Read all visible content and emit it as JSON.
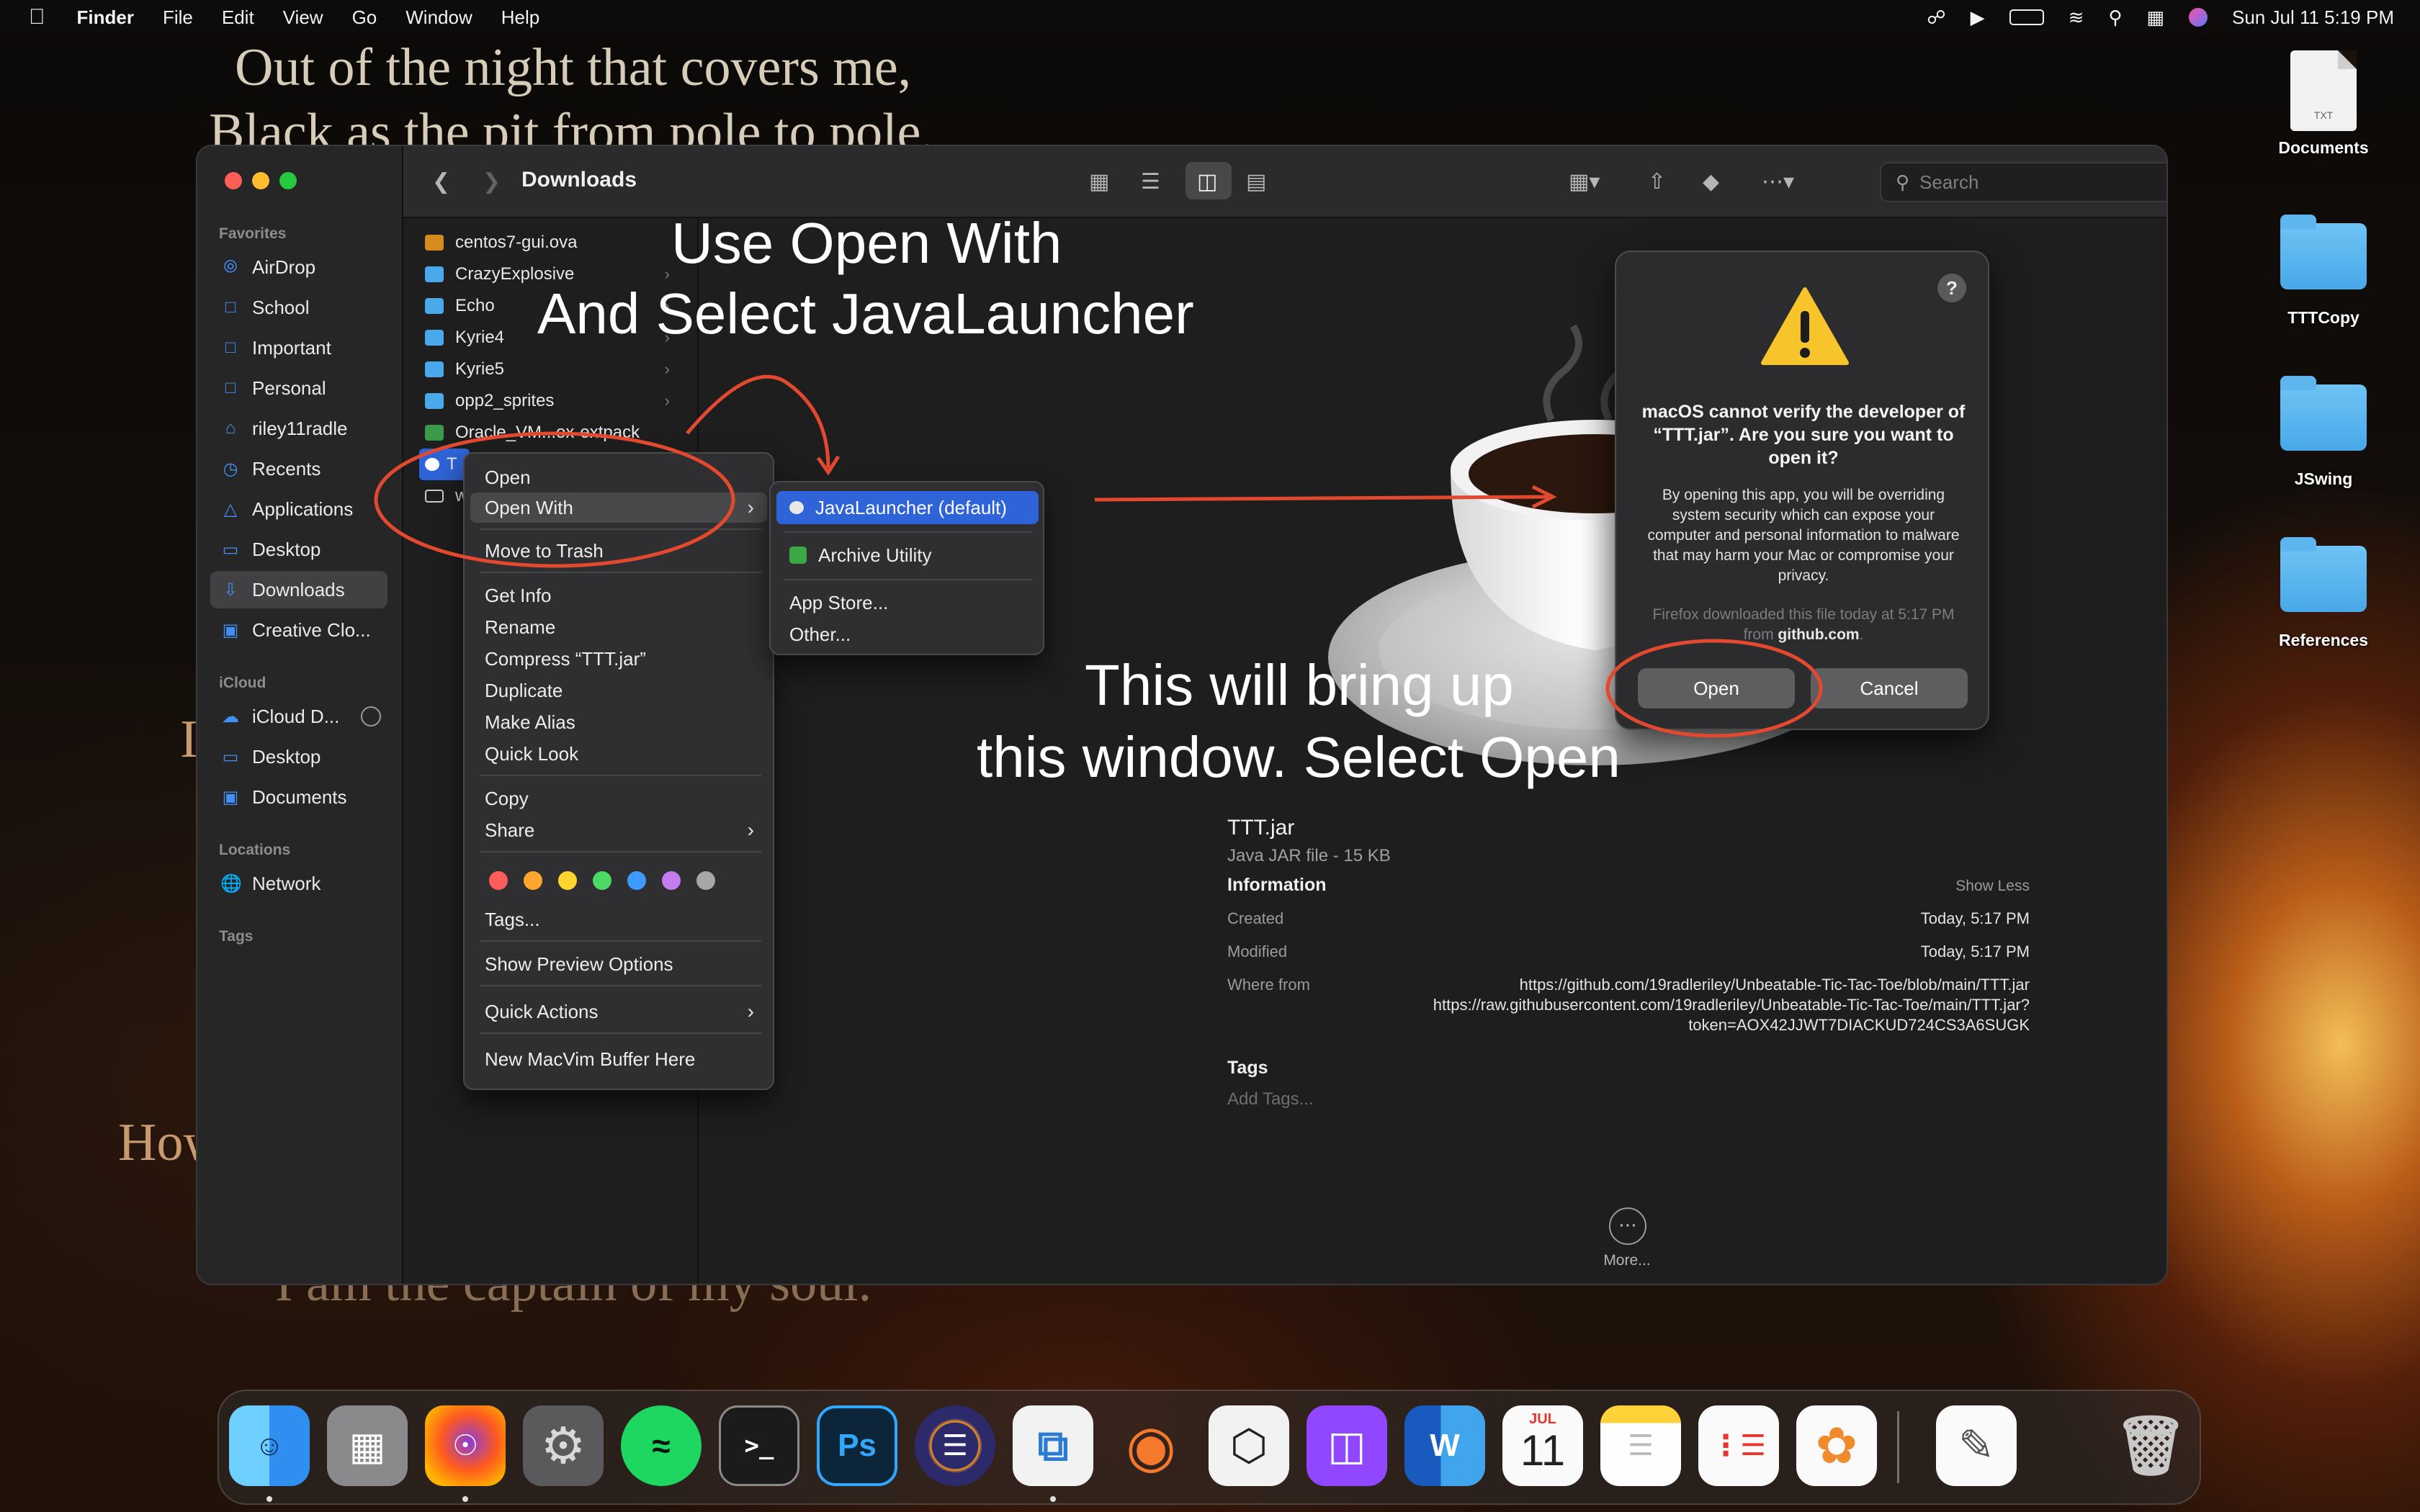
{
  "menubar": {
    "app_name": "Finder",
    "items": [
      "File",
      "Edit",
      "View",
      "Go",
      "Window",
      "Help"
    ],
    "datetime": "Sun Jul 11  5:19 PM"
  },
  "wallpaper": {
    "poem_line_1": "Out of the night that covers me,",
    "poem_line_2": "Black as the pit from pole to pole,",
    "poem_fragment_left": "I",
    "poem_fragment_how": "How",
    "poem_last_line": "I am the captain of my soul."
  },
  "desktop": {
    "icons": [
      {
        "label": "Documents",
        "doc_badge": "TXT"
      },
      {
        "label": "TTTCopy"
      },
      {
        "label": "JSwing"
      },
      {
        "label": "References"
      }
    ]
  },
  "finder": {
    "title": "Downloads",
    "search_placeholder": "Search",
    "sidebar": {
      "favorites_header": "Favorites",
      "favorites": [
        "AirDrop",
        "School",
        "Important",
        "Personal",
        "riley11radle",
        "Recents",
        "Applications",
        "Desktop",
        "Downloads",
        "Creative Clo..."
      ],
      "icloud_header": "iCloud",
      "icloud": [
        "iCloud D...",
        "Desktop",
        "Documents"
      ],
      "locations_header": "Locations",
      "locations": [
        "Network"
      ],
      "tags_header": "Tags"
    },
    "files": [
      "centos7-gui.ova",
      "CrazyExplosive",
      "Echo",
      "Kyrie4",
      "Kyrie5",
      "opp2_sprites",
      "Oracle_VM...ox-extpack",
      "T",
      "w"
    ],
    "preview": {
      "name": "TTT.jar",
      "kind": "Java JAR file - 15 KB",
      "info_header": "Information",
      "show_less": "Show Less",
      "created_label": "Created",
      "created_value": "Today, 5:17 PM",
      "modified_label": "Modified",
      "modified_value": "Today, 5:17 PM",
      "where_from_label": "Where from",
      "where_from_1": "https://github.com/19radleriley/Unbeatable-Tic-Tac-Toe/blob/main/TTT.jar",
      "where_from_2": "https://raw.githubusercontent.com/19radleriley/Unbeatable-Tic-Tac-Toe/main/TTT.jar?",
      "where_from_3": "token=AOX42JJWT7DIACKUD724CS3A6SUGK",
      "tags_header": "Tags",
      "add_tags": "Add Tags...",
      "more": "More..."
    }
  },
  "context_menu": {
    "items": [
      "Open",
      "Open With",
      "Move to Trash",
      "Get Info",
      "Rename",
      "Compress “TTT.jar”",
      "Duplicate",
      "Make Alias",
      "Quick Look",
      "Copy",
      "Share",
      "Tags...",
      "Show Preview Options",
      "Quick Actions",
      "New MacVim Buffer Here"
    ],
    "tag_colors": [
      "#ff5c5c",
      "#ffa530",
      "#ffd52e",
      "#4cd964",
      "#3d9bff",
      "#c47cf0",
      "#a7a7a9"
    ]
  },
  "submenu": {
    "items": [
      "JavaLauncher (default)",
      "Archive Utility",
      "App Store...",
      "Other..."
    ]
  },
  "dialog": {
    "title": "macOS cannot verify the developer of “TTT.jar”. Are you sure you want to open it?",
    "body": "By opening this app, you will be overriding system security which can expose your computer and personal information to malware that may harm your Mac or compromise your privacy.",
    "note_prefix": "Firefox downloaded this file today at 5:17 PM from ",
    "note_source": "github.com",
    "note_suffix": ".",
    "help": "?",
    "open_button": "Open",
    "cancel_button": "Cancel"
  },
  "annotations": {
    "line1": "Use Open With",
    "line2": "And Select JavaLauncher",
    "line3": "This will bring up",
    "line4": "this window. Select Open",
    "color": "#e2492f"
  },
  "dock": {
    "apps": [
      "Finder",
      "Launchpad",
      "Firefox",
      "System Preferences",
      "Spotify",
      "Terminal",
      "Photoshop",
      "Eclipse",
      "Visual Studio Code",
      "Blender",
      "Unity",
      "Twitch",
      "Word",
      "Calendar",
      "Notes",
      "Reminders",
      "Photos",
      "TextEdit",
      "Trash"
    ],
    "calendar_month": "JUL",
    "calendar_day": "11",
    "photoshop_label": "Ps",
    "word_label": "W",
    "terminal_label": ">_"
  }
}
